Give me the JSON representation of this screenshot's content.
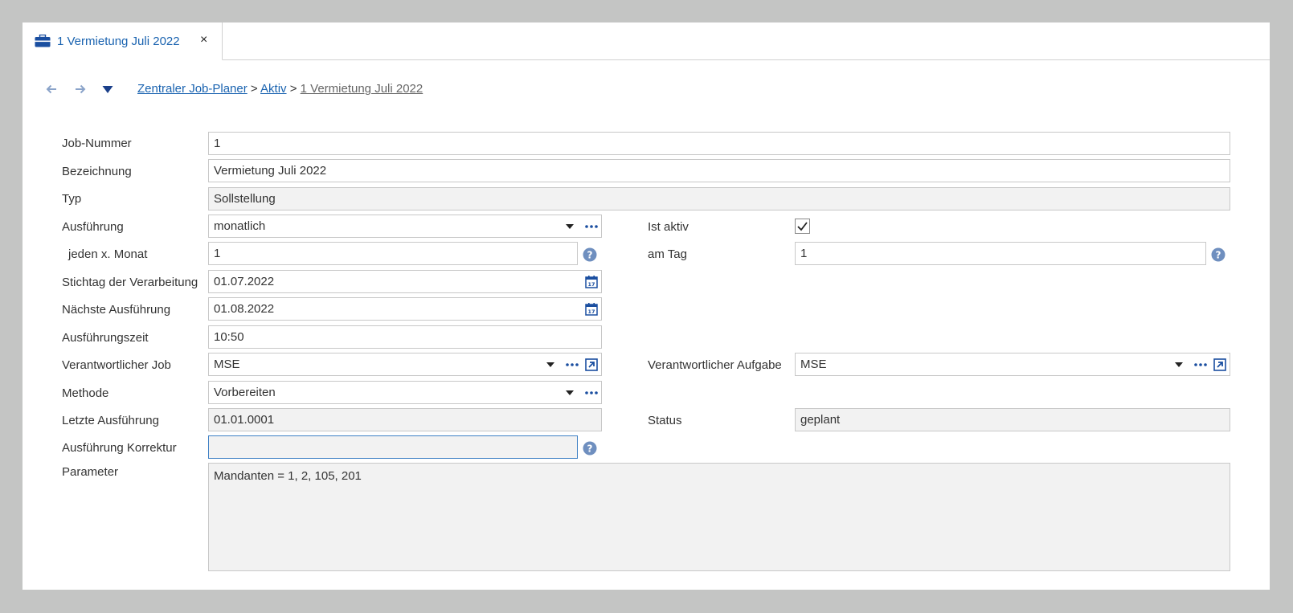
{
  "tab": {
    "title": "1 Vermietung Juli 2022",
    "close": "×"
  },
  "breadcrumb": {
    "items": [
      "Zentraler Job-Planer",
      "Aktiv"
    ],
    "current": "1 Vermietung Juli 2022",
    "separator": ">"
  },
  "form": {
    "job_nummer": {
      "label": "Job-Nummer",
      "value": "1"
    },
    "bezeichnung": {
      "label": "Bezeichnung",
      "value": "Vermietung Juli 2022"
    },
    "typ": {
      "label": "Typ",
      "value": "Sollstellung"
    },
    "ausfuehrung": {
      "label": "Ausführung",
      "value": "monatlich"
    },
    "ist_aktiv": {
      "label": "Ist aktiv",
      "checked": true
    },
    "jeden_monat": {
      "label": "jeden x. Monat",
      "value": "1"
    },
    "am_tag": {
      "label": "am Tag",
      "value": "1"
    },
    "stichtag": {
      "label": "Stichtag der Verarbeitung",
      "value": "01.07.2022"
    },
    "naechste": {
      "label": "Nächste Ausführung",
      "value": "01.08.2022"
    },
    "zeit": {
      "label": "Ausführungszeit",
      "value": "10:50"
    },
    "verantw_job": {
      "label": "Verantwortlicher Job",
      "value": "MSE"
    },
    "verantw_aufgabe": {
      "label": "Verantwortlicher Aufgabe",
      "value": "MSE"
    },
    "methode": {
      "label": "Methode",
      "value": "Vorbereiten"
    },
    "letzte": {
      "label": "Letzte Ausführung",
      "value": "01.01.0001"
    },
    "status": {
      "label": "Status",
      "value": "geplant"
    },
    "korrektur": {
      "label": "Ausführung Korrektur",
      "value": ""
    },
    "parameter": {
      "label": "Parameter",
      "value": "Mandanten = 1, 2, 105, 201"
    }
  },
  "colors": {
    "accent": "#1a63b0",
    "help": "#6f8fbf",
    "readonly_bg": "#f2f2f2"
  },
  "icons": [
    "briefcase-icon",
    "back-arrow-icon",
    "forward-arrow-icon",
    "dropdown-icon",
    "ellipsis-icon",
    "calendar-icon",
    "open-link-icon",
    "help-icon",
    "check-icon",
    "close-icon"
  ]
}
